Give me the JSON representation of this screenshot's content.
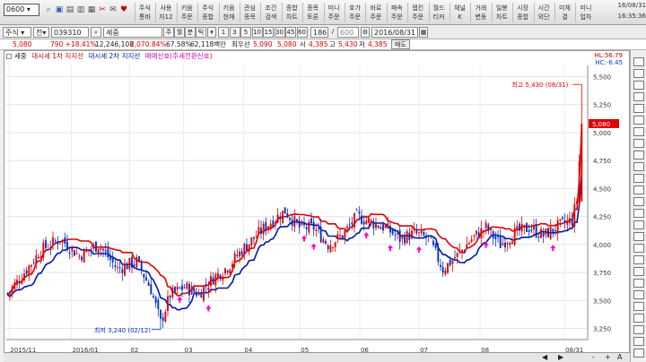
{
  "toolbar": {
    "code": "0600",
    "buttons": [
      [
        "주식",
        "통바"
      ],
      [
        "사용",
        "자12"
      ],
      [
        "키움",
        "주문"
      ],
      [
        "주식",
        "종합"
      ],
      [
        "키움",
        "현재"
      ],
      [
        "관심",
        "종목"
      ],
      [
        "조건",
        "검색"
      ],
      [
        "종합",
        "차트"
      ],
      [
        "종목",
        "토론"
      ],
      [
        "미니",
        "주문"
      ],
      [
        "호가",
        "주문"
      ],
      [
        "바로",
        "주문"
      ],
      [
        "패속",
        "주문"
      ],
      [
        "랩킨",
        "주문"
      ],
      [
        "월드",
        "티커"
      ],
      [
        "채널",
        "K"
      ],
      [
        "거래",
        "변동"
      ],
      [
        "일봉",
        "차트"
      ],
      [
        "시장",
        "종합"
      ],
      [
        "시간",
        "외단"
      ],
      [
        "미체",
        "결"
      ],
      [
        "미니",
        "업차"
      ]
    ],
    "datetime": "16/08/31",
    "time": "16:35:36"
  },
  "row2": {
    "market": "주식",
    "type": "전",
    "code": "039310",
    "name": "세중",
    "period_labels": [
      "주",
      "월",
      "분",
      "틱"
    ],
    "intervals": [
      "1",
      "3",
      "5",
      "10",
      "15",
      "30",
      "45",
      "60"
    ],
    "count": "186",
    "total": "600",
    "date": "2016/08/31"
  },
  "quote": {
    "price": "5,080",
    "change": "790 +18.41%",
    "volume": "12,246,108",
    "amount": "2,070.84%",
    "rate": "67.58%",
    "value": "62,118백만",
    "prev_label": "최우선",
    "best_ask": "5,090",
    "best_bid": "5,080",
    "open_label": "시",
    "open": "4,385",
    "high_label": "고",
    "high": "5,430",
    "low_label": "저",
    "low": "4,385",
    "buy_btn": "매도"
  },
  "legend": {
    "stock": "세중",
    "ind1": "대시세 1차 지지선",
    "ind2": "대시세 2차 지지선",
    "ind3": "매매신호(추세전환신호)"
  },
  "topright": {
    "hl": "HL:56.79",
    "lc": "HC:-6.45"
  },
  "annotations": {
    "max": "최고 5,430 (08/31)",
    "min": "최저 3,240 (02/12)"
  },
  "colors": {
    "up": "#e00000",
    "down": "#0030c0",
    "line1": "#e00000",
    "line2": "#0018a8",
    "signal": "#ff00cc"
  },
  "chart_data": {
    "type": "candlestick",
    "yticks": [
      "5,500",
      "5,250",
      "5,000",
      "4,750",
      "4,500",
      "4,250",
      "4,000",
      "3,750",
      "3,500",
      "3,250"
    ],
    "ylim": [
      3150,
      5600
    ],
    "xticks": [
      "2015/11",
      "2016/01",
      "02",
      "03",
      "04",
      "05",
      "06",
      "07",
      "08",
      "08/31"
    ]
  },
  "bottom": {
    "left": "◀",
    "right": "▶",
    "minus": "-",
    "plus": "+",
    "a": "A"
  }
}
